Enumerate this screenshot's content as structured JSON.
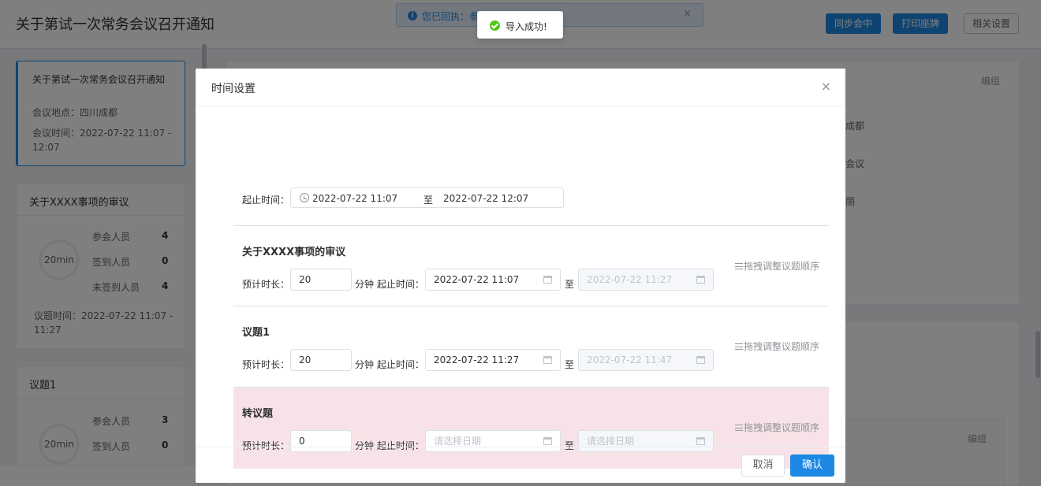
{
  "page": {
    "title": "关于第试一次常务会议召开通知",
    "buttons": {
      "sync": "同步会中",
      "print": "打印座牌",
      "settings": "相关设置"
    },
    "info_banner": "您已回执：参加",
    "close_glyph": "×"
  },
  "sidebar": {
    "meeting": {
      "title": "关于第试一次常务会议召开通知",
      "location": "会议地点：四川成都",
      "time": "会议时间：2022-07-22 11:07 - 12:07"
    },
    "topics": [
      {
        "title": "关于XXXX事项的审议",
        "duration": "20min",
        "stats": [
          {
            "label": "参会人员",
            "value": "4"
          },
          {
            "label": "签到人员",
            "value": "0"
          },
          {
            "label": "未签到人员",
            "value": "4"
          }
        ],
        "topic_time": "议题时间：2022-07-22 11:07 - 11:27"
      },
      {
        "title": "议题1",
        "duration": "20min",
        "stats": [
          {
            "label": "参会人员",
            "value": "3"
          },
          {
            "label": "签到人员",
            "value": "0"
          }
        ]
      }
    ]
  },
  "right": {
    "edit_label": "编组",
    "lines": [
      "成都",
      "会议",
      "丽"
    ],
    "edit_label2": "编组"
  },
  "toast": {
    "text": "导入成功!"
  },
  "dialog": {
    "title": "时间设置",
    "close_glyph": "×",
    "range_label": "起止时间：",
    "range_start": "2022-07-22 11:07",
    "range_sep": "至",
    "range_end": "2022-07-22 12:07",
    "duration_label": "预计时长：",
    "unit_label": "分钟 起止时间：",
    "to_label": "至",
    "drag_hint": "拖拽调整议题顺序",
    "sections": [
      {
        "title": "关于XXXX事项的审议",
        "duration": "20",
        "start": "2022-07-22 11:07",
        "end": "2022-07-22 11:27"
      },
      {
        "title": "议题1",
        "duration": "20",
        "start": "2022-07-22 11:27",
        "end": "2022-07-22 11:47"
      },
      {
        "title": "转议题",
        "duration": "0",
        "start": "请选择日期",
        "end": "请选择日期"
      }
    ],
    "cancel": "取消",
    "confirm": "确认"
  }
}
